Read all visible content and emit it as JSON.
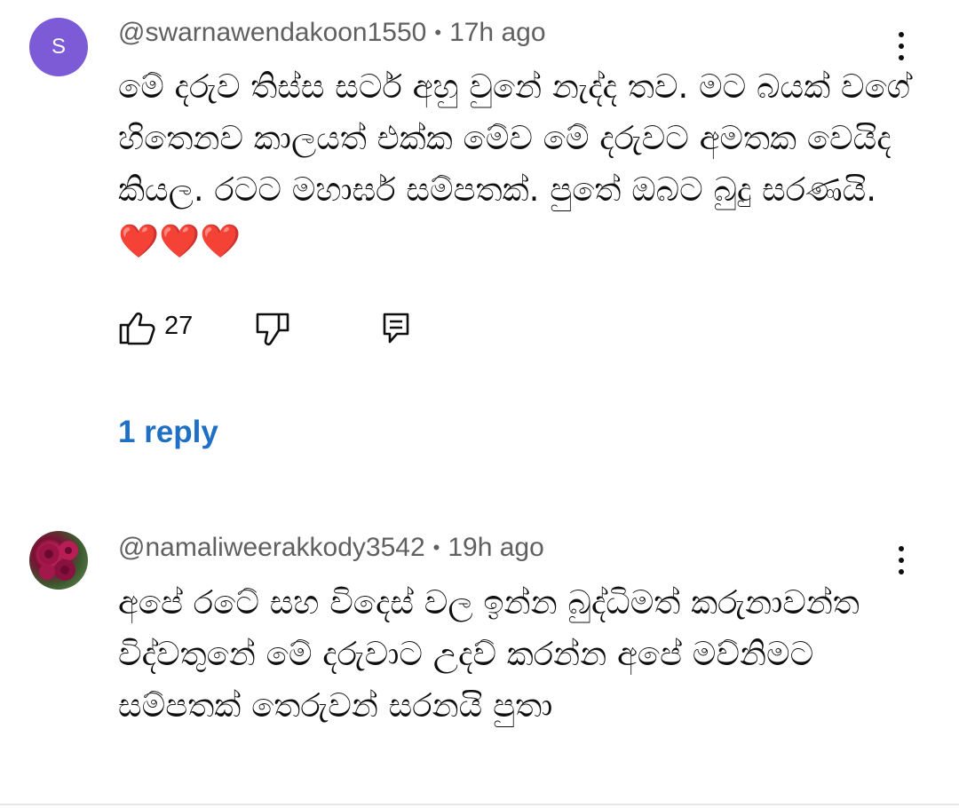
{
  "comments": [
    {
      "avatar_letter": "S",
      "avatar_color": "#7d5ad6",
      "username": "@swarnawendakoon1550",
      "separator": "•",
      "time": "17h ago",
      "text": "මේ දරුව තිස්ස සර්ට අහු වුනේ නැද්ද තව. මට බයක් වගේ හිතෙනව කාලයත් එක්ක මේව මේ දරුවට අමතක වෙයිද කියල. රටට මහාර්ඝ සම්පතක්. පුතේ ඔබට බුදු සරණයි.❤️❤️❤️",
      "likes": "27",
      "replies_label": "1 reply"
    },
    {
      "avatar_icon": "rose-icon",
      "username": "@namaliweerakkody3542",
      "separator": "•",
      "time": "19h ago",
      "text": "අපේ රටේ සහ විදෙස් වල ඉන්න බුද්ධිමත් කරුනාවන්ත විද්වතුනේ මේ දරුවාට උදව් කරන්න අපේ මව්නිමට සම්පතක් තෙරුවන් සරනයි පුතා"
    }
  ],
  "icons": {
    "like": "thumbs-up-icon",
    "dislike": "thumbs-down-icon",
    "reply": "reply-icon",
    "more": "more-vert-icon"
  },
  "colors": {
    "link": "#1f6fc5",
    "meta": "#606060"
  }
}
